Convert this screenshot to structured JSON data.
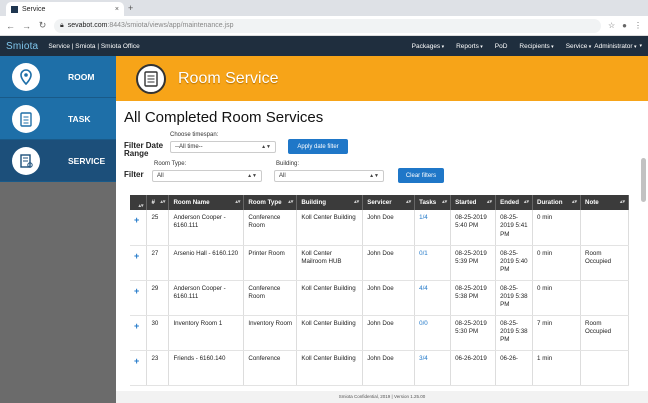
{
  "browser": {
    "tab_title": "Service",
    "tab_close": "×",
    "new_tab": "+",
    "url_host": "sevabot.com",
    "url_rest": ":8443/smiota/views/app/maintenance.jsp"
  },
  "app": {
    "brand": "Smiota",
    "nav_title": "Service | Smiota | Smiota Office",
    "menu": [
      "Packages",
      "Reports",
      "PoD",
      "Recipients",
      "Service",
      "Administrator"
    ]
  },
  "sidebar": {
    "items": [
      {
        "label": "ROOM",
        "icon": "location-pin-icon"
      },
      {
        "label": "TASK",
        "icon": "clipboard-icon"
      },
      {
        "label": "SERVICE",
        "icon": "service-list-icon"
      }
    ]
  },
  "banner": {
    "title": "Room Service"
  },
  "page": {
    "title": "All Completed Room Services"
  },
  "filters": {
    "date_label": "Filter Date Range",
    "timespan_label": "Choose timespan:",
    "timespan_value": "--All time--",
    "apply_label": "Apply date filter",
    "filter_label": "Filter",
    "room_type_label": "Room Type:",
    "room_type_value": "All",
    "building_label": "Building:",
    "building_value": "All",
    "clear_label": "Clear filters"
  },
  "table": {
    "columns": [
      "#",
      "Room Name",
      "Room Type",
      "Building",
      "Servicer",
      "Tasks",
      "Started",
      "Ended",
      "Duration",
      "Note"
    ],
    "rows": [
      {
        "num": "25",
        "room": "Anderson Cooper - 6160.111",
        "type": "Conference Room",
        "building": "Koll Center Building",
        "servicer": "John Doe",
        "tasks": "1/4",
        "started": "08-25-2019 5:40 PM",
        "ended": "08-25-2019 5:41 PM",
        "duration": "0 min",
        "note": ""
      },
      {
        "num": "27",
        "room": "Arsenio Hall - 6160.120",
        "type": "Printer Room",
        "building": "Koll Center Mailroom HUB",
        "servicer": "John Doe",
        "tasks": "0/1",
        "started": "08-25-2019 5:39 PM",
        "ended": "08-25-2019 5:40 PM",
        "duration": "0 min",
        "note": "Room Occupied"
      },
      {
        "num": "29",
        "room": "Anderson Cooper - 6160.111",
        "type": "Conference Room",
        "building": "Koll Center Building",
        "servicer": "John Doe",
        "tasks": "4/4",
        "started": "08-25-2019 5:38 PM",
        "ended": "08-25-2019 5:38 PM",
        "duration": "0 min",
        "note": ""
      },
      {
        "num": "30",
        "room": "Inventory Room 1",
        "type": "Inventory Room",
        "building": "Koll Center Building",
        "servicer": "John Doe",
        "tasks": "0/0",
        "started": "08-25-2019 5:30 PM",
        "ended": "08-25-2019 5:38 PM",
        "duration": "7 min",
        "note": "Room Occupied"
      },
      {
        "num": "23",
        "room": "Friends - 6160.140",
        "type": "Conference",
        "building": "Koll Center Building",
        "servicer": "John Doe",
        "tasks": "3/4",
        "started": "06-26-2019",
        "ended": "06-26-",
        "duration": "1 min",
        "note": ""
      }
    ]
  },
  "footer": {
    "text": "Smiota Confidential, 2019 | Version 1.25.00"
  },
  "colors": {
    "banner": "#f7a418",
    "sidebar": "#1e6fa8",
    "navbar": "#1f2e3e",
    "accent": "#1f77c8"
  }
}
